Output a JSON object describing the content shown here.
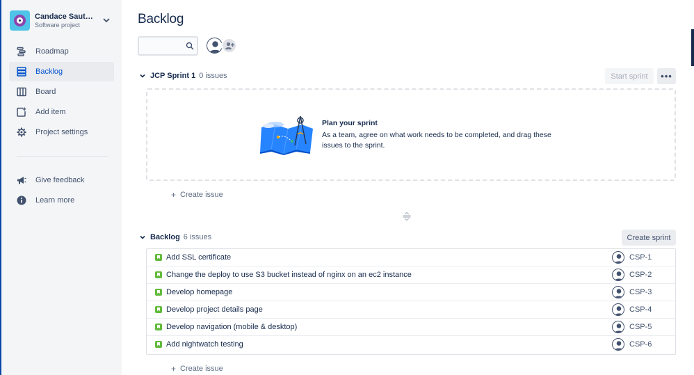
{
  "project": {
    "name": "Candace Sautm...",
    "type": "Software project"
  },
  "sidebar": {
    "items": [
      {
        "label": "Roadmap",
        "icon": "roadmap-icon",
        "active": false
      },
      {
        "label": "Backlog",
        "icon": "backlog-icon",
        "active": true
      },
      {
        "label": "Board",
        "icon": "board-icon",
        "active": false
      },
      {
        "label": "Add item",
        "icon": "add-item-icon",
        "active": false
      },
      {
        "label": "Project settings",
        "icon": "gear-icon",
        "active": false
      }
    ],
    "footer_items": [
      {
        "label": "Give feedback",
        "icon": "megaphone-icon"
      },
      {
        "label": "Learn more",
        "icon": "info-icon"
      }
    ]
  },
  "page": {
    "title": "Backlog",
    "search_placeholder": ""
  },
  "sprint": {
    "name": "JCP Sprint 1",
    "count": "0 issues",
    "start_label": "Start sprint",
    "more_label": "•••",
    "empty_title": "Plan your sprint",
    "empty_desc": "As a team, agree on what work needs to be completed, and drag these issues to the sprint.",
    "create_issue": "Create issue"
  },
  "backlog": {
    "name": "Backlog",
    "count": "6 issues",
    "create_sprint_label": "Create sprint",
    "create_issue": "Create issue",
    "issues": [
      {
        "summary": "Add SSL certificate",
        "key": "CSP-1"
      },
      {
        "summary": "Change the deploy to use S3 bucket instead of nginx on an ec2 instance",
        "key": "CSP-2"
      },
      {
        "summary": "Develop homepage",
        "key": "CSP-3"
      },
      {
        "summary": "Develop project details page",
        "key": "CSP-4"
      },
      {
        "summary": "Develop navigation (mobile & desktop)",
        "key": "CSP-5"
      },
      {
        "summary": "Add nightwatch testing",
        "key": "CSP-6"
      }
    ]
  },
  "colors": {
    "accent": "#0052cc",
    "story": "#63ba3c",
    "sidebar_bg": "#f4f5f7",
    "text": "#172b4d"
  }
}
